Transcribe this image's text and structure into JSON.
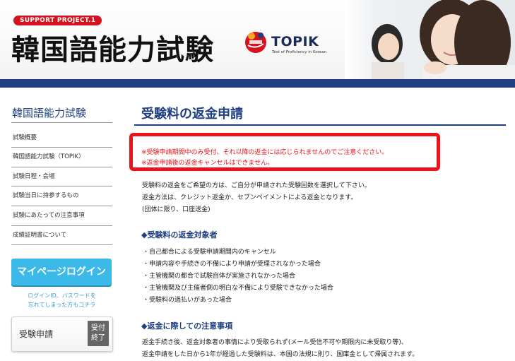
{
  "header": {
    "badge": "SUPPORT PROJECT.1",
    "title": "韓国語能力試験",
    "logo_word": "TOPIK",
    "logo_sub": "Test of Proficiency in Korean",
    "brand_color": "#1f3f82"
  },
  "sidebar": {
    "title": "韓国語能力試験",
    "items": [
      {
        "label": "試験概要"
      },
      {
        "label": "韓国語能力試験（TOPIK）"
      },
      {
        "label": "試験日程・会場"
      },
      {
        "label": "試験当日に持参するもの"
      },
      {
        "label": "試験にあたっての注意事項"
      },
      {
        "label": "成績証明書について"
      }
    ],
    "login_label": "マイページログイン",
    "forgot_line1": "ログインID、パスワードを",
    "forgot_line2": "忘れてしまった方もコチラ",
    "apply_label": "受験申請",
    "apply_badge_line1": "受付",
    "apply_badge_line2": "終了"
  },
  "main": {
    "title": "受験料の返金申請",
    "notice": [
      "※受験申請期間中のみ受付、それ以降の返金には応じられませんのでご注意ください。",
      "※返金申請後の返金キャンセルはできません。"
    ],
    "notice_color": "#e8131b",
    "intro": [
      "受験料の返金をご希望の方は、ご自分が申請された受験回数を選択して下さい。",
      "返金方法は、クレジット返金か、セブンペイメントによる返金となります。",
      "(団体に限り、口座送金)"
    ],
    "section1": {
      "heading": "◆受験料の返金対象者",
      "items": [
        "・自己都合による受験申請期間内のキャンセル",
        "・申請内容や手続きの不備により申請が受理されなかった場合",
        "・主管機関の都合で試験自体が実施されなかった場合",
        "・主管機関及び主催者側の明白な不備により受験できなかった場合",
        "・受験料の過払いがあった場合"
      ]
    },
    "section2": {
      "heading": "◆返金に際しての注意事項",
      "lines": [
        "返金手続き後、返金対象者の事情により受取られず(メール受信不可や期限内に未受取り等)、",
        "返金申請をした日から1年が経過した受験料は、本国の法規に則り、国庫金として帰属されます。"
      ]
    }
  }
}
